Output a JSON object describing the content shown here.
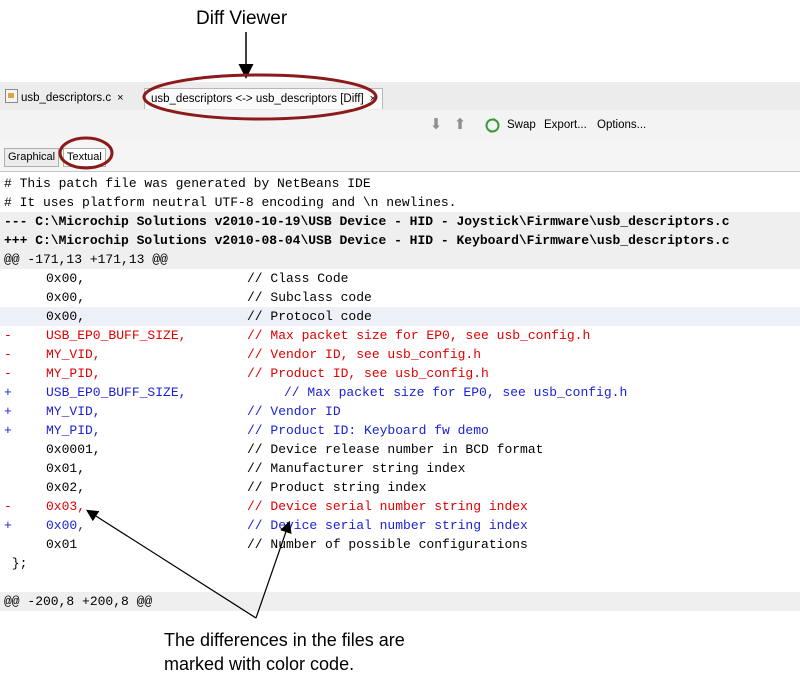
{
  "callouts": {
    "title": "Diff Viewer",
    "note_line1": "The differences in the files are",
    "note_line2": "marked with color code."
  },
  "tabs": [
    {
      "label": "usb_descriptors.c",
      "close": "×"
    },
    {
      "label": "usb_descriptors <-> usb_descriptors [Diff]",
      "close": "×"
    }
  ],
  "toolbar": {
    "down_arrow": "⬇",
    "up_arrow": "⬆",
    "swap": "Swap",
    "export": "Export...",
    "options": "Options..."
  },
  "view_tabs": {
    "graphical": "Graphical",
    "textual": "Textual"
  },
  "colors": {
    "removed": "#e00000",
    "added": "#1a22d6",
    "callout_ring": "#8b1a1a"
  },
  "diff": {
    "header": [
      "# This patch file was generated by NetBeans IDE",
      "# It uses platform neutral UTF-8 encoding and \\n newlines.",
      "--- C:\\Microchip Solutions v2010-10-19\\USB Device - HID - Joystick\\Firmware\\usb_descriptors.c",
      "+++ C:\\Microchip Solutions v2010-08-04\\USB Device - HID - Keyboard\\Firmware\\usb_descriptors.c",
      "@@ -171,13 +171,13 @@"
    ],
    "rows": [
      {
        "marker": "",
        "code": "0x00,",
        "comment": "// Class Code",
        "type": "context"
      },
      {
        "marker": "",
        "code": "0x00,",
        "comment": "// Subclass code",
        "type": "context"
      },
      {
        "marker": "",
        "code": "0x00,",
        "comment": "// Protocol code",
        "type": "context"
      },
      {
        "marker": "-",
        "code": "USB_EP0_BUFF_SIZE,",
        "comment": "// Max packet size for EP0, see usb_config.h",
        "type": "removed"
      },
      {
        "marker": "-",
        "code": "MY_VID,",
        "comment": "// Vendor ID, see usb_config.h",
        "type": "removed"
      },
      {
        "marker": "-",
        "code": "MY_PID,",
        "comment": "// Product ID, see usb_config.h",
        "type": "removed"
      },
      {
        "marker": "+",
        "code": "USB_EP0_BUFF_SIZE,",
        "comment": "// Max packet size for EP0, see usb_config.h",
        "type": "added"
      },
      {
        "marker": "+",
        "code": "MY_VID,",
        "comment": "// Vendor ID",
        "type": "added"
      },
      {
        "marker": "+",
        "code": "MY_PID,",
        "comment": "// Product ID: Keyboard fw demo",
        "type": "added"
      },
      {
        "marker": "",
        "code": "0x0001,",
        "comment": "// Device release number in BCD format",
        "type": "context"
      },
      {
        "marker": "",
        "code": "0x01,",
        "comment": "// Manufacturer string index",
        "type": "context"
      },
      {
        "marker": "",
        "code": "0x02,",
        "comment": "// Product string index",
        "type": "context"
      },
      {
        "marker": "-",
        "code": "0x03,",
        "comment": "// Device serial number string index",
        "type": "removed"
      },
      {
        "marker": "+",
        "code": "0x00,",
        "comment": "// Device serial number string index",
        "type": "added"
      },
      {
        "marker": "",
        "code": "0x01",
        "comment": "// Number of possible configurations",
        "type": "context"
      }
    ],
    "closing": " };",
    "hunk2": "@@ -200,8 +200,8 @@"
  }
}
